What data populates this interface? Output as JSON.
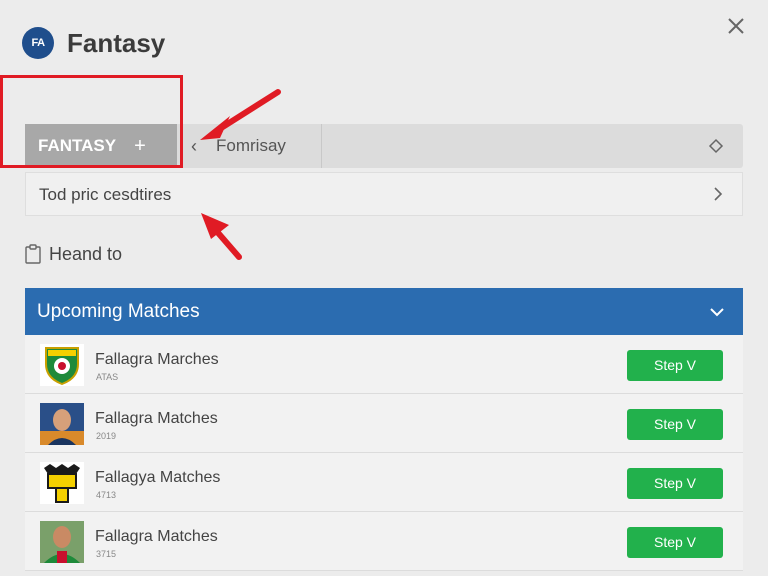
{
  "header": {
    "logo_text": "FA",
    "app_title": "Fantasy"
  },
  "tabs": {
    "active_label": "FANTASY",
    "add_symbol": "+",
    "back_symbol": "‹",
    "second_label": "Fomrisay"
  },
  "price_row": {
    "label": "Tod pric cesdtires"
  },
  "heand": {
    "label": "Heand to"
  },
  "matches": {
    "title": "Upcoming Matches",
    "rows": [
      {
        "name": "Fallagra Marches",
        "sub": "ATAS",
        "button": "Step V"
      },
      {
        "name": "Fallagra Matches",
        "sub": "2019",
        "button": "Step V"
      },
      {
        "name": "Fallagya Matches",
        "sub": "4713",
        "button": "Step V"
      },
      {
        "name": "Fallagra Matches",
        "sub": "3715",
        "button": "Step V"
      }
    ]
  },
  "colors": {
    "accent_blue": "#2b6cb0",
    "button_green": "#22b14c",
    "annotation_red": "#e01b24"
  },
  "icons": {
    "close": "close-icon",
    "tag": "tag-icon",
    "chevron_right": "chevron-right-icon",
    "chevron_down": "chevron-down-icon",
    "clipboard": "clipboard-icon"
  }
}
